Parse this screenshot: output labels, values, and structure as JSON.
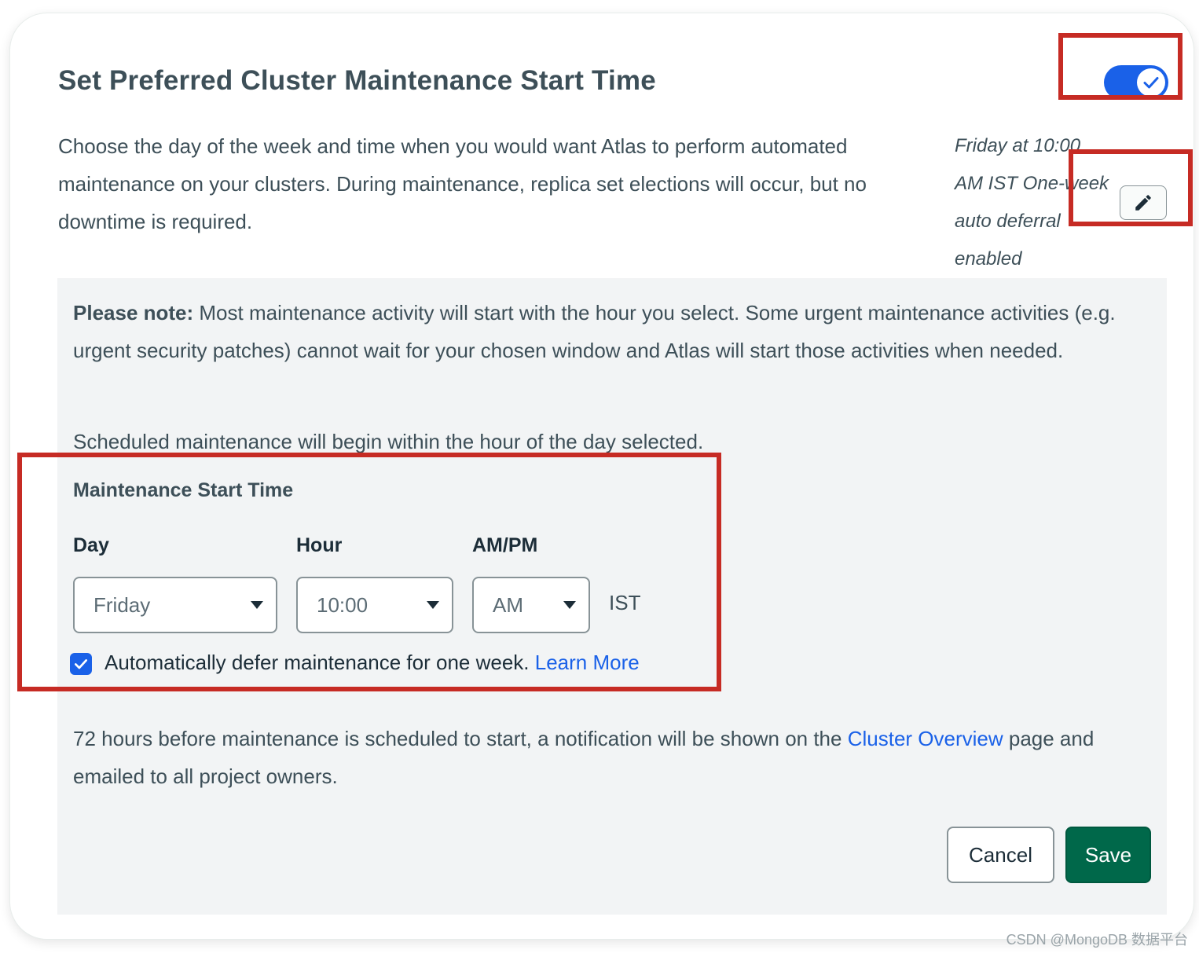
{
  "header": {
    "title": "Set Preferred Cluster Maintenance Start Time",
    "toggle_on": true
  },
  "description": "Choose the day of the week and time when you would want Atlas to perform automated maintenance on your clusters. During maintenance, replica set elections will occur, but no downtime is required.",
  "summary": {
    "line1": "Friday at 10:00",
    "line2": "AM IST One-week",
    "line3": "auto deferral",
    "line4": "enabled"
  },
  "panel": {
    "note_label": "Please note:",
    "note_text": " Most maintenance activity will start with the hour you select. Some urgent maintenance activities (e.g. urgent security patches) cannot wait for your chosen window and Atlas will start those activities when needed.",
    "scheduled_text": "Scheduled maintenance will begin within the hour of the day selected.",
    "start_time_title": "Maintenance Start Time",
    "fields": {
      "day_label": "Day",
      "day_value": "Friday",
      "hour_label": "Hour",
      "hour_value": "10:00",
      "ampm_label": "AM/PM",
      "ampm_value": "AM",
      "timezone": "IST"
    },
    "defer": {
      "checked": true,
      "label": "Automatically defer maintenance for one week. ",
      "link": "Learn More"
    },
    "notification": {
      "before": "72 hours before maintenance is scheduled to start, a notification will be shown on the ",
      "link": "Cluster Overview",
      "after": " page and emailed to all project owners."
    },
    "buttons": {
      "cancel": "Cancel",
      "save": "Save"
    }
  },
  "colors": {
    "accent_blue": "#1a61e8",
    "save_green": "#00684a",
    "highlight_red": "#c62b24",
    "panel_gray": "#f2f4f5"
  },
  "watermark": "CSDN @MongoDB 数据平台"
}
